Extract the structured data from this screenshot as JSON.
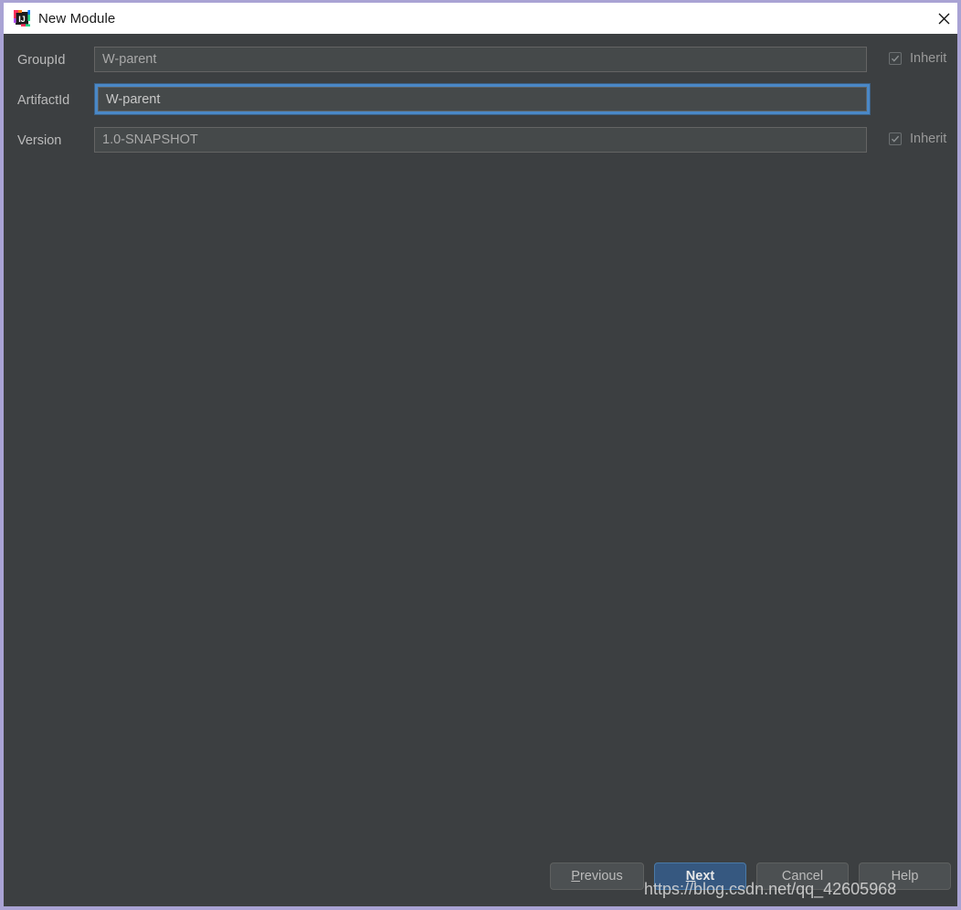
{
  "window": {
    "title": "New Module",
    "app_icon": "intellij-idea-icon",
    "close_label": "✕",
    "border_color": "#a9a3d4",
    "titlebar_bg": "#ffffff",
    "dialog_bg": "#3c3f41"
  },
  "form": {
    "rows": [
      {
        "label": "GroupId",
        "value": "W-parent",
        "focused": false,
        "inherit": {
          "label": "Inherit",
          "checked": true,
          "enabled": false
        }
      },
      {
        "label": "ArtifactId",
        "value": "W-parent",
        "focused": true,
        "inherit": null
      },
      {
        "label": "Version",
        "value": "1.0-SNAPSHOT",
        "focused": false,
        "inherit": {
          "label": "Inherit",
          "checked": true,
          "enabled": false
        }
      }
    ]
  },
  "buttons": {
    "previous": {
      "label": "Previous",
      "mnemonic": "P",
      "rest": "revious",
      "default": false
    },
    "next": {
      "label": "Next",
      "mnemonic": "N",
      "rest": "ext",
      "default": true
    },
    "cancel": {
      "label": "Cancel",
      "default": false
    },
    "help": {
      "label": "Help",
      "default": false
    }
  },
  "watermark": {
    "text": "https://blog.csdn.net/qq_42605968"
  },
  "colors": {
    "accent_focus": "#4a88c7",
    "default_button": "#365880",
    "field_bg": "#45494a",
    "text_muted": "#bbbbbb"
  }
}
